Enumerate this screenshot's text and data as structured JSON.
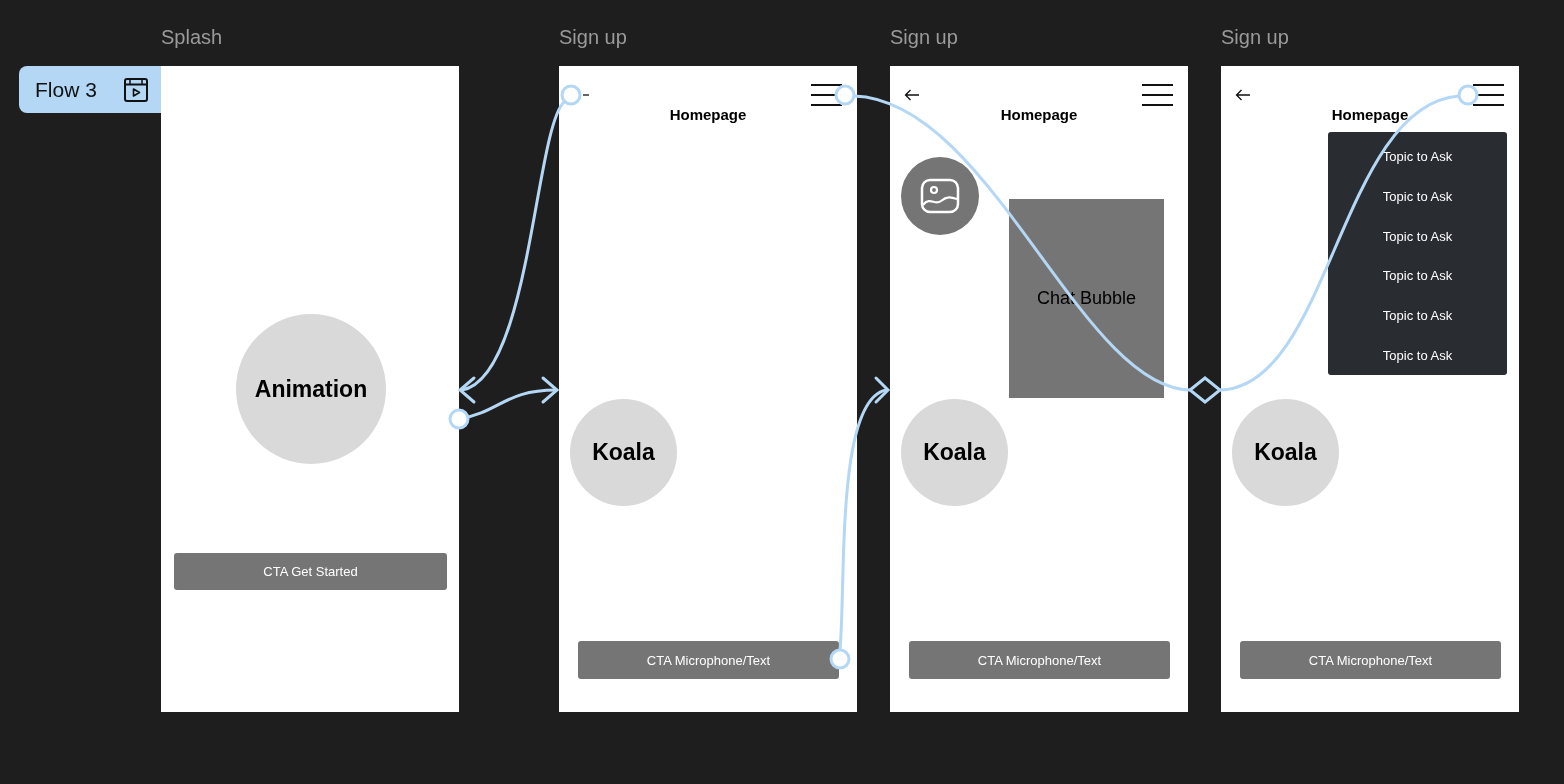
{
  "flow": {
    "label": "Flow 3"
  },
  "frames": [
    {
      "title": "Splash",
      "kind": "splash",
      "hero": "Animation",
      "cta": "CTA Get Started"
    },
    {
      "title": "Sign up",
      "kind": "home",
      "back_arrow": true,
      "back_arrow_under_connector": true,
      "menu_icon": true,
      "header": "Homepage",
      "mascot": "Koala",
      "cta": "CTA Microphone/Text"
    },
    {
      "title": "Sign up",
      "kind": "home",
      "back_arrow": true,
      "menu_icon": true,
      "header": "Homepage",
      "avatar_image": true,
      "chat_bubble": "Chat Bubble",
      "mascot": "Koala",
      "cta": "CTA Microphone/Text"
    },
    {
      "title": "Sign up",
      "kind": "home",
      "back_arrow": true,
      "menu_icon": true,
      "header": "Homepage",
      "menu_items": [
        "Topic to Ask",
        "Topic to Ask",
        "Topic to Ask",
        "Topic to Ask",
        "Topic to Ask",
        "Topic to Ask"
      ],
      "mascot": "Koala",
      "cta": "CTA Microphone/Text"
    }
  ]
}
